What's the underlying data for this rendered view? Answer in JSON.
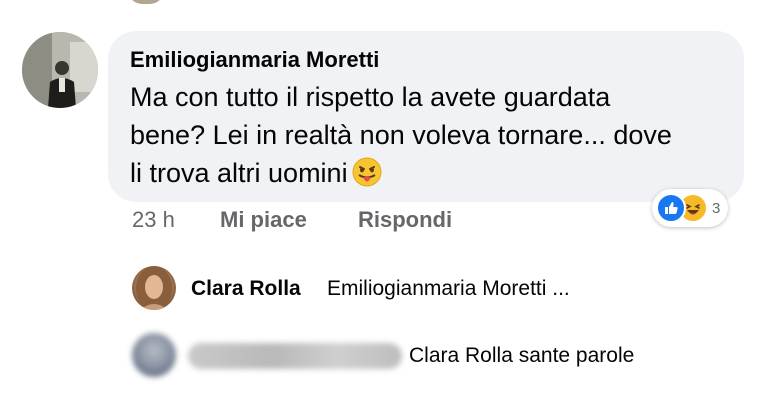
{
  "comment": {
    "author": "Emiliogianmaria Moretti",
    "text_lines": [
      "Ma con tutto il rispetto la avete guardata",
      "bene? Lei in realtà non voleva tornare... dove",
      "li trova altri uomini"
    ],
    "emoji": "😛",
    "reactions": {
      "icons": [
        "like-icon",
        "haha-icon"
      ],
      "count": "3"
    },
    "meta": {
      "time": "23 h",
      "like_label": "Mi piace",
      "reply_label": "Rispondi"
    }
  },
  "replies": [
    {
      "author": "Clara Rolla",
      "text": "Emiliogianmaria Moretti ..."
    },
    {
      "author_blurred": true,
      "text": "Clara Rolla sante parole"
    }
  ],
  "colors": {
    "bubble_bg": "#f0f2f5",
    "meta_text": "#65676b",
    "like_blue": "#1877f2",
    "haha_yellow": "#f7b928"
  }
}
